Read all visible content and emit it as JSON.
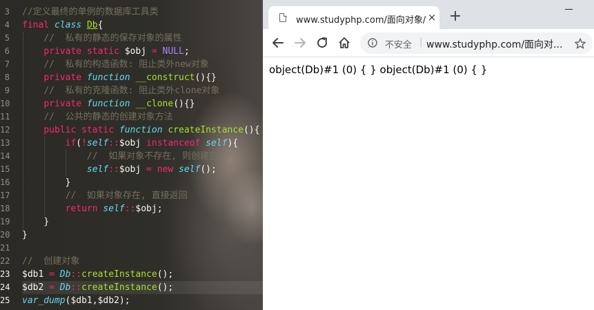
{
  "editor": {
    "line_numbers": [
      "3",
      "4",
      "5",
      "6",
      "7",
      "8",
      "9",
      "10",
      "11",
      "12",
      "13",
      "14",
      "15",
      "16",
      "17",
      "18",
      "19",
      "20",
      "21",
      "22",
      "23",
      "24",
      "25"
    ],
    "code": {
      "l3_comment": "//定义最终的单例的数据库工具类",
      "l4_final": "final",
      "l4_class": "class",
      "l4_name": "Db",
      "l4_brace": "{",
      "l5_comment": "//  私有的静态的保存对象的属性",
      "l6_private": "private",
      "l6_static": "static",
      "l6_var": "$obj",
      "l6_eq": "=",
      "l6_null": "NULL",
      "l6_semi": ";",
      "l7_comment": "//  私有的构造函数: 阻止类外new对象",
      "l8_private": "private",
      "l8_function": "function",
      "l8_name": "__construct",
      "l8_rest": "(){}",
      "l9_comment": "//  私有的克隆函数: 阻止类外clone对象",
      "l10_private": "private",
      "l10_function": "function",
      "l10_name": "__clone",
      "l10_rest": "(){}",
      "l11_comment": "//  公共的静态的创建对象方法",
      "l12_public": "public",
      "l12_static": "static",
      "l12_function": "function",
      "l12_name": "createInstance",
      "l12_rest": "(){",
      "l13_if": "if",
      "l13_open": "(",
      "l13_not": "!",
      "l13_self": "self",
      "l13_dc": "::",
      "l13_var": "$obj",
      "l13_instanceof": "instanceof",
      "l13_self2": "self",
      "l13_close": "){",
      "l14_comment": "//  如果对象不存在, 则创建它",
      "l15_self": "self",
      "l15_dc": "::",
      "l15_var": "$obj",
      "l15_eq": "=",
      "l15_new": "new",
      "l15_self2": "self",
      "l15_rest": "();",
      "l16_brace": "}",
      "l17_comment": "//  如果对象存在, 直接返回",
      "l18_return": "return",
      "l18_self": "self",
      "l18_dc": "::",
      "l18_var": "$obj;",
      "l19_brace": "}",
      "l20_brace": "}",
      "l22_comment": "//  创建对象",
      "l23_var": "$db1",
      "l23_eq": "=",
      "l23_cls": "Db",
      "l23_dc": "::",
      "l23_fn": "createInstance",
      "l23_rest": "();",
      "l24_var": "$db2",
      "l24_eq": "=",
      "l24_cls": "Db",
      "l24_dc": "::",
      "l24_fn": "createInstance",
      "l24_rest": "();",
      "l25_fn": "var_dump",
      "l25_rest": "($db1,$db2);"
    }
  },
  "browser": {
    "tab_title": "www.studyphp.com/面向对象/cl",
    "tab_close": "×",
    "new_tab": "+",
    "security_label": "不安全",
    "url_separator": "|",
    "url": "www.studyphp.com/面向对...",
    "output": "object(Db)#1 (0) { } object(Db)#1 (0) { }",
    "icons": [
      "page-icon",
      "close-icon",
      "plus-icon",
      "minimize-icon",
      "back-arrow-icon",
      "forward-arrow-icon",
      "reload-icon",
      "home-icon",
      "info-icon",
      "star-icon"
    ]
  },
  "colors": {
    "keyword": "#f92672",
    "storage": "#66d9ef",
    "function": "#a6e22e",
    "constant": "#ae81ff",
    "comment": "#75715e",
    "text": "#f8f8f2"
  }
}
